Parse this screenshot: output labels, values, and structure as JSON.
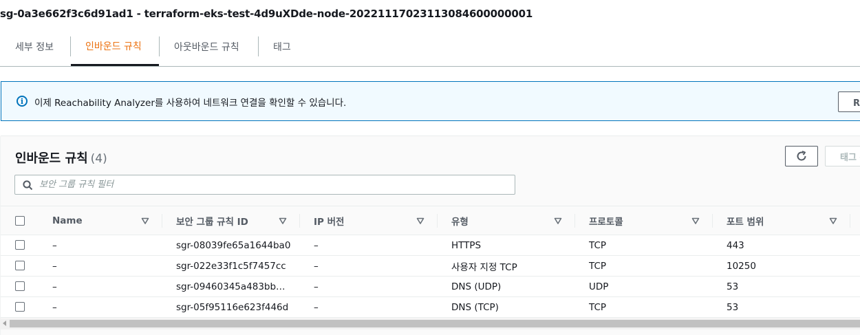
{
  "page": {
    "title": "sg-0a3e662f3c6d91ad1 - terraform-eks-test-4d9uXDde-node-20221117023113084600000001"
  },
  "tabs": [
    {
      "label": "세부 정보",
      "active": false
    },
    {
      "label": "인바운드 규칙",
      "active": true
    },
    {
      "label": "아웃바운드 규칙",
      "active": false
    },
    {
      "label": "태그",
      "active": false
    }
  ],
  "banner": {
    "icon": "info-icon",
    "text": "이제 Reachability Analyzer를 사용하여 네트워크 연결을 확인할 수 있습니다.",
    "button_label": "Reachability Analyzer 실행"
  },
  "panel": {
    "title": "인바운드 규칙",
    "count": "(4)",
    "refresh_icon": "refresh-icon",
    "tag_button_label": "태그 관리"
  },
  "search": {
    "placeholder": "보안 그룹 규칙 필터",
    "value": ""
  },
  "table": {
    "columns": [
      "Name",
      "보안 그룹 규칙 ID",
      "IP 버전",
      "유형",
      "프로토콜",
      "포트 범위"
    ],
    "rows": [
      {
        "name": "–",
        "rule_id": "sgr-08039fe65a1644ba0",
        "ip_version": "–",
        "type": "HTTPS",
        "protocol": "TCP",
        "port_range": "443"
      },
      {
        "name": "–",
        "rule_id": "sgr-022e33f1c5f7457cc",
        "ip_version": "–",
        "type": "사용자 지정 TCP",
        "protocol": "TCP",
        "port_range": "10250"
      },
      {
        "name": "–",
        "rule_id": "sgr-09460345a483bb…",
        "ip_version": "–",
        "type": "DNS (UDP)",
        "protocol": "UDP",
        "port_range": "53"
      },
      {
        "name": "–",
        "rule_id": "sgr-05f95116e623f446d",
        "ip_version": "–",
        "type": "DNS (TCP)",
        "protocol": "TCP",
        "port_range": "53"
      }
    ]
  },
  "colors": {
    "accent": "#ec7211",
    "info_blue": "#0073bb",
    "banner_bg": "#f1faff",
    "text": "#16191f",
    "muted": "#545b64"
  }
}
